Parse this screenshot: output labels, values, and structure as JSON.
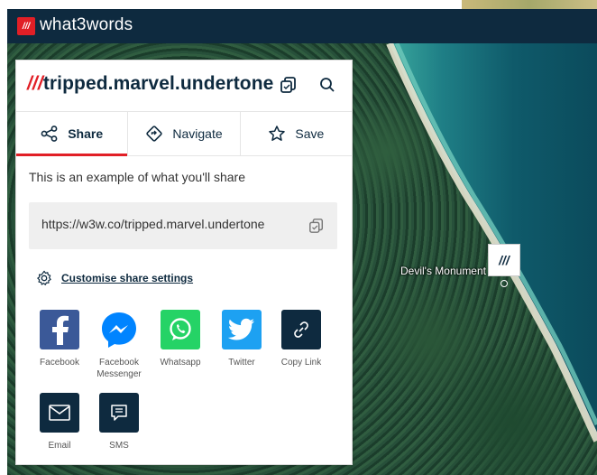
{
  "app": {
    "brand": "what3words",
    "logo_icon": "w3w-logo-icon"
  },
  "panel": {
    "address_prefix": "///",
    "address": "tripped.marvel.undertone",
    "tabs": [
      {
        "label": "Share",
        "icon": "share-icon",
        "active": true
      },
      {
        "label": "Navigate",
        "icon": "navigate-icon",
        "active": false
      },
      {
        "label": "Save",
        "icon": "star-icon",
        "active": false
      }
    ],
    "intro": "This is an example of what you'll share",
    "share_url": "https://w3w.co/tripped.marvel.undertone",
    "customise_label": "Customise share settings",
    "share_options": [
      {
        "label": "Facebook",
        "icon": "facebook-icon",
        "color": "#3b5998"
      },
      {
        "label": "Facebook Messenger",
        "icon": "messenger-icon",
        "color": "#0084ff"
      },
      {
        "label": "Whatsapp",
        "icon": "whatsapp-icon",
        "color": "#25d366"
      },
      {
        "label": "Twitter",
        "icon": "twitter-icon",
        "color": "#1da1f2"
      },
      {
        "label": "Copy Link",
        "icon": "link-icon",
        "color": "#0e2a3f"
      },
      {
        "label": "Email",
        "icon": "email-icon",
        "color": "#0e2a3f"
      },
      {
        "label": "SMS",
        "icon": "sms-icon",
        "color": "#0e2a3f"
      }
    ]
  },
  "map": {
    "place_label": "Devil's Monument",
    "marker_text": "///"
  },
  "colors": {
    "brand_dark": "#0e2a3f",
    "accent_red": "#e11f26"
  }
}
